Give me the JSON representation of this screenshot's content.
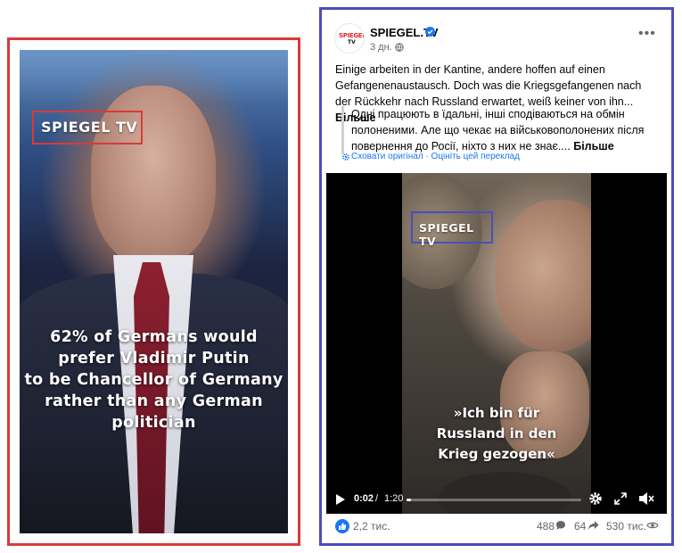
{
  "left_post": {
    "watermark": "SPIEGEL TV",
    "caption_lines": [
      "62% of Germans would",
      "prefer Vladimir Putin",
      "to be Chancellor of Germany",
      "rather than any German",
      "politician"
    ],
    "frame_color": "#d83a3a"
  },
  "right_post": {
    "frame_color": "#4a4fb8",
    "page": {
      "avatar_top": "SPIEGEL",
      "avatar_bottom": "TV",
      "name": "SPIEGEL.TV",
      "time": "3 дн. ·",
      "verified_icon": "verified-badge-icon",
      "audience_icon": "globe-icon"
    },
    "text": {
      "body": "Einige arbeiten in der Kantine, andere hoffen auf einen Gefangenenaustausch. Doch was die Kriegsgefangenen nach der Rückkehr nach Russland erwartet, weiß keiner von ihn...",
      "more": "Більше"
    },
    "translation": {
      "body": "Одні працюють в їдальні, інші сподіваються на обмін полоненими. Але що чекає на військовополонених після повернення до Росії, ніхто з них не знає....",
      "more": "Більше",
      "hide_original": "Сховати оригінал",
      "separator": " · ",
      "rate": "Оцініть цей переклад"
    },
    "video": {
      "watermark": "SPIEGEL TV",
      "caption_lines": [
        "»Ich bin für",
        "Russland in den",
        "Krieg gezogen«"
      ],
      "time_current": "0:02",
      "time_separator": "/",
      "time_total": "1:20",
      "progress": 0.025
    },
    "stats": {
      "likes": "2,2 тис.",
      "comments": "488",
      "shares": "64",
      "views": "530 тис."
    },
    "accent_color": "#1877f2"
  }
}
